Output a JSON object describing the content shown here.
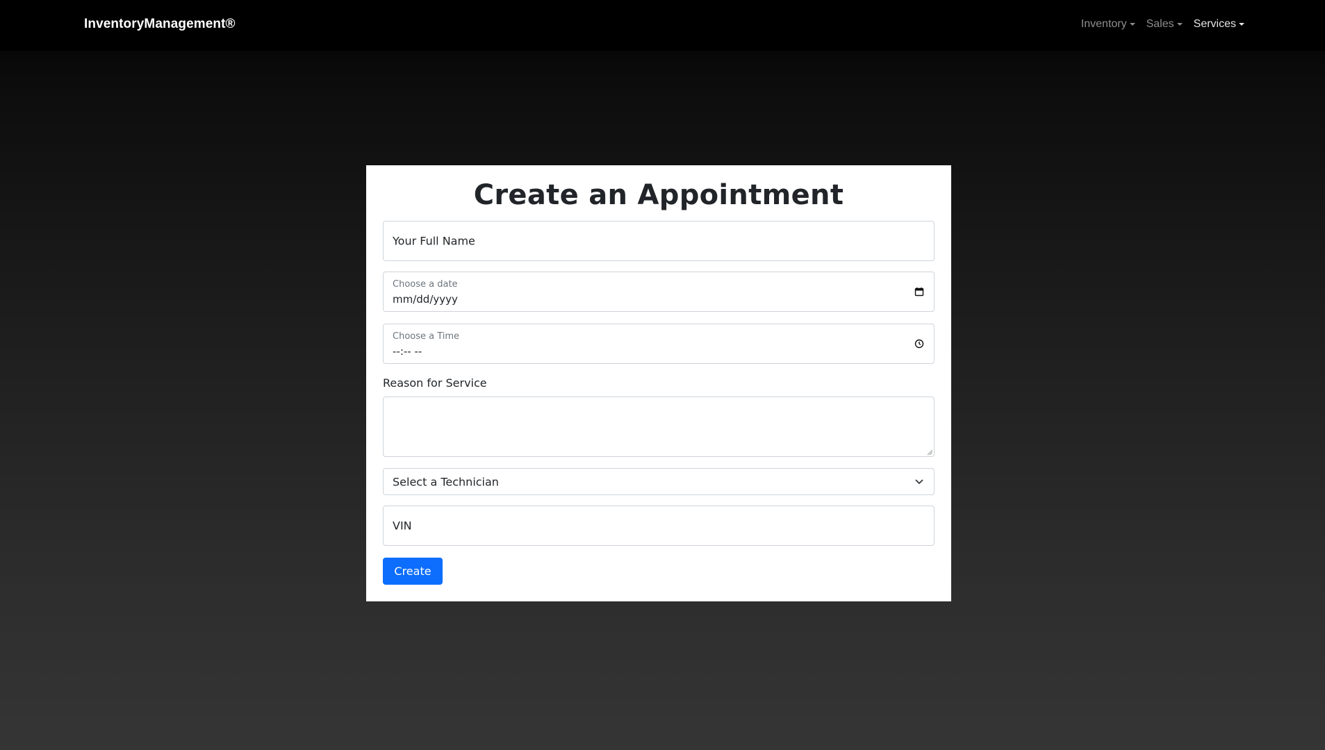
{
  "navbar": {
    "brand": "InventoryManagement®",
    "items": [
      {
        "label": "Inventory",
        "active": false
      },
      {
        "label": "Sales",
        "active": false
      },
      {
        "label": "Services",
        "active": true
      }
    ]
  },
  "form": {
    "title": "Create an Appointment",
    "full_name": {
      "placeholder": "Your Full Name",
      "value": ""
    },
    "date": {
      "label": "Choose a date",
      "value": "mm/dd/yyyy",
      "icon": "calendar-icon"
    },
    "time": {
      "label": "Choose a Time",
      "value": "--:-- --",
      "icon": "clock-icon"
    },
    "reason": {
      "label": "Reason for Service",
      "value": ""
    },
    "technician": {
      "selected": "Select a Technician",
      "icon": "chevron-down-icon"
    },
    "vin": {
      "placeholder": "VIN",
      "value": ""
    },
    "submit_label": "Create"
  },
  "colors": {
    "primary_button": "#0d6efd",
    "navbar_bg": "#000000",
    "card_bg": "#ffffff",
    "border": "#ced4da"
  }
}
